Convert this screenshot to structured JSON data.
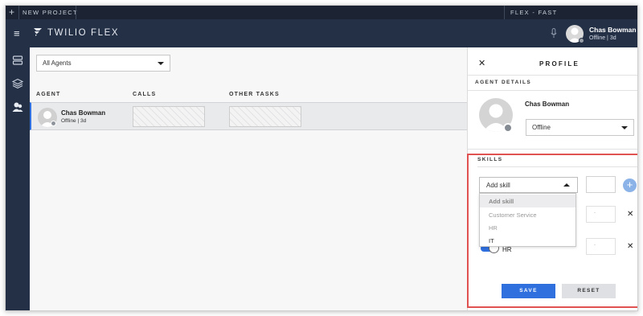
{
  "topbar": {
    "new_project": "NEW PROJECT",
    "flex_fast": "FLEX - FAST"
  },
  "header": {
    "brand": "TWILIO FLEX",
    "user_name": "Chas Bowman",
    "user_status": "Offline | 3d"
  },
  "sidenav": {
    "icons": [
      "layers-stack-icon",
      "layers-icon",
      "agents-icon"
    ]
  },
  "main": {
    "filter_select": "All Agents",
    "columns": [
      "AGENT",
      "CALLS",
      "OTHER TASKS"
    ],
    "rows": [
      {
        "name": "Chas Bowman",
        "status": "Offline | 3d"
      }
    ]
  },
  "profile": {
    "title": "PROFILE",
    "agent_details_label": "AGENT DETAILS",
    "name": "Chas Bowman",
    "status_select": "Offline",
    "skills_label": "SKILLS",
    "add_skill_placeholder": "Add skill",
    "dropdown_options": [
      "Add skill",
      "Customer Service",
      "HR",
      "IT"
    ],
    "skill_level_placeholder": "-",
    "hr_skill": "HR",
    "save_label": "SAVE",
    "reset_label": "RESET"
  },
  "colors": {
    "header_bg": "#243046",
    "accent_blue": "#2f6fde",
    "highlight_red": "#e05252"
  }
}
